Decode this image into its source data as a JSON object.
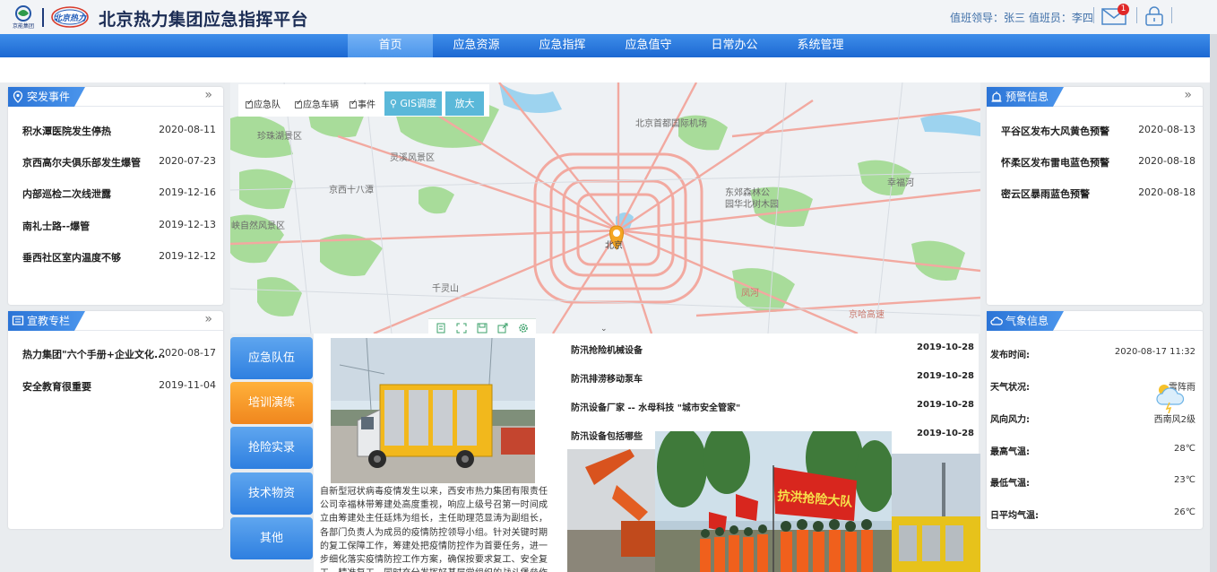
{
  "header": {
    "logo_group_text": "京能集团",
    "logo_brand_text": "北京热力",
    "title": "北京热力集团应急指挥平台",
    "duty_text": "值班领导：张三 值班员：李四",
    "mail_badge": "1"
  },
  "nav": {
    "items": [
      {
        "label": "首页",
        "active": true
      },
      {
        "label": "应急资源"
      },
      {
        "label": "应急指挥"
      },
      {
        "label": "应急值守"
      },
      {
        "label": "日常办公"
      },
      {
        "label": "系统管理"
      }
    ]
  },
  "incidents": {
    "title": "突发事件",
    "more": "»",
    "items": [
      {
        "title": "积水潭医院发生停热",
        "date": "2020-08-11"
      },
      {
        "title": "京西高尔夫俱乐部发生爆管",
        "date": "2020-07-23"
      },
      {
        "title": "内部巡检二次线泄露",
        "date": "2019-12-16"
      },
      {
        "title": "南礼士路--爆管",
        "date": "2019-12-13"
      },
      {
        "title": "垂西社区室内温度不够",
        "date": "2019-12-12"
      }
    ]
  },
  "promo": {
    "title": "宣教专栏",
    "more": "»",
    "items": [
      {
        "title": "热力集团\"六个手册+企业文化...",
        "date": "2020-08-17"
      },
      {
        "title": "安全教育很重要",
        "date": "2019-11-04"
      }
    ]
  },
  "map": {
    "controls": {
      "team": "应急队",
      "vehicle": "应急车辆",
      "event": "事件",
      "gis_button": "GIS调度",
      "zoom_button": "放大"
    },
    "labels": {
      "airport": "北京首都国际机场",
      "zhuwo": "珍珠湖景区",
      "lingxi": "灵溪风景区",
      "jingxi": "京西十八潭",
      "xiayun": "峡自然风景区",
      "qianling": "千灵山",
      "beijing": "北京",
      "dongjiao": "东郊森林公\n园华北树木园",
      "xingfu": "幸福河",
      "jinghu": "京哈高速",
      "jingcheng": "京承高速",
      "fengzhu": "凤河"
    }
  },
  "warnings": {
    "title": "预警信息",
    "more": "»",
    "items": [
      {
        "title": "平谷区发布大风黄色预警",
        "date": "2020-08-13"
      },
      {
        "title": "怀柔区发布雷电蓝色预警",
        "date": "2020-08-18"
      },
      {
        "title": "密云区暴雨蓝色预警",
        "date": "2020-08-18"
      }
    ]
  },
  "weather": {
    "title": "气象信息",
    "publish_label": "发布时间:",
    "publish_value": "2020-08-17 11:32",
    "sky_label": "天气状况:",
    "sky_value": "雷阵雨",
    "wind_label": "风向风力:",
    "wind_value": "西南风2级",
    "high_label": "最高气温:",
    "high_value": "28℃",
    "low_label": "最低气温:",
    "low_value": "23℃",
    "avg_label": "日平均气温:",
    "avg_value": "26℃"
  },
  "tabs": [
    {
      "label": "应急队伍"
    },
    {
      "label": "培训演练",
      "active": true
    },
    {
      "label": "抢险实录"
    },
    {
      "label": "技术物资"
    },
    {
      "label": "其他"
    }
  ],
  "news": {
    "text": "自新型冠状病毒疫情发生以来，西安市热力集团有限责任公司幸福林带筹建处高度重视，响应上级号召第一时间成立由筹建处主任廷炜为组长，主任助理范显涛为副组长，各部门负责人为成员的疫情防控领导小组。针对关键时期的复工保障工作，筹建处把疫情防控作为首要任务，进一步细化落实疫情防控工作方案，确保按要求复工、安全复工、精准复工，同时充分发挥好基层党组织的战斗堡垒作用和党员的先"
  },
  "documents": [
    {
      "title": "防汛抢险机械设备",
      "date": "2019-10-28"
    },
    {
      "title": "防汛排涝移动泵车",
      "date": "2019-10-28"
    },
    {
      "title": "防汛设备厂家 -- 水母科技 \"城市安全管家\"",
      "date": "2019-10-28"
    },
    {
      "title": "防汛设备包括哪些",
      "date": "2019-10-28"
    }
  ],
  "photos": {
    "banner_text": "抗洪抢险大队"
  }
}
